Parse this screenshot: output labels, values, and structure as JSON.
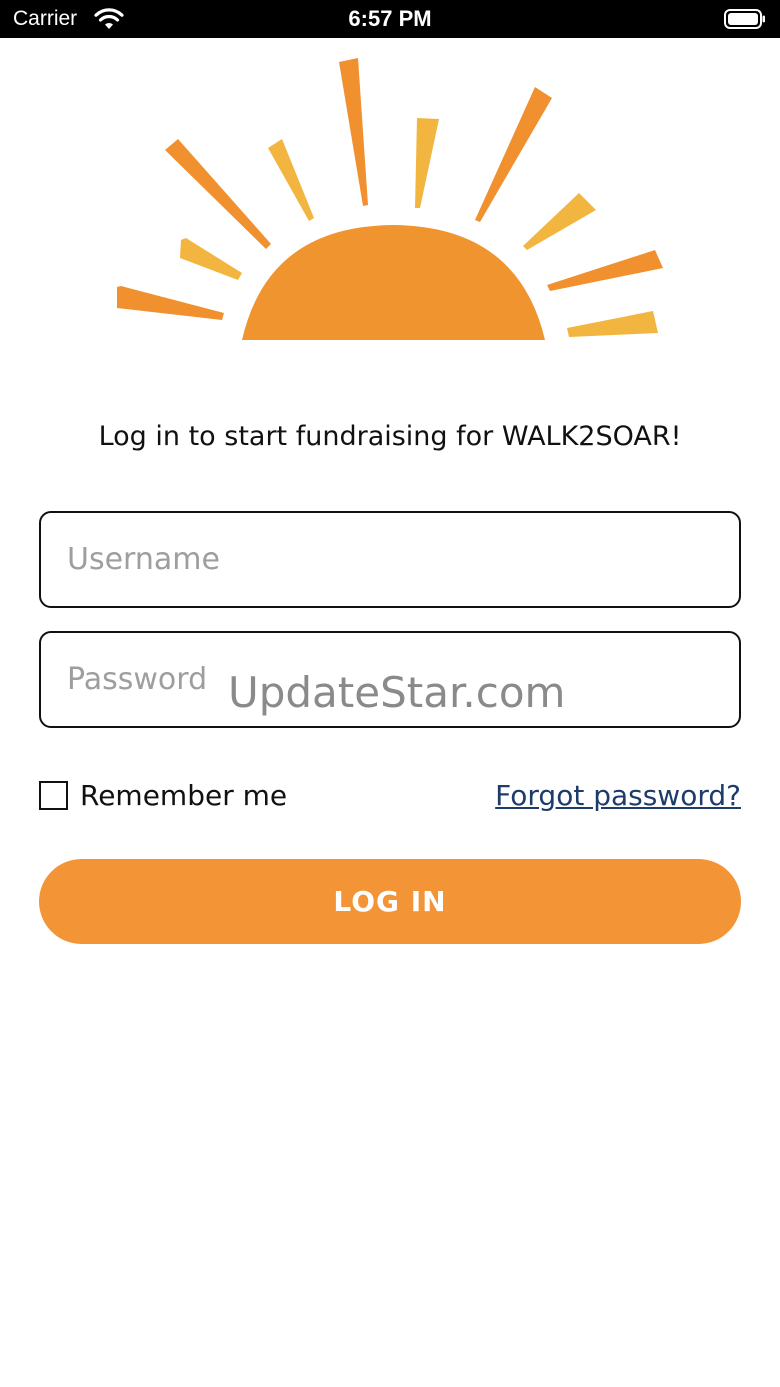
{
  "status_bar": {
    "carrier": "Carrier",
    "time": "6:57 PM",
    "wifi_icon": "wifi-icon",
    "battery_icon": "battery-icon"
  },
  "logo": {
    "icon": "sunrise-logo",
    "colors": {
      "sun": "#f0942f",
      "ray_dark": "#f0902e",
      "ray_light": "#f2b540"
    }
  },
  "tagline": "Log in to start fundraising for WALK2SOAR!",
  "form": {
    "username": {
      "placeholder": "Username",
      "value": ""
    },
    "password": {
      "placeholder": "Password",
      "value": ""
    },
    "remember_me": {
      "label": "Remember me",
      "checked": false
    },
    "forgot_password": "Forgot password?",
    "login_label": "LOG IN"
  },
  "watermark": "UpdateStar.com",
  "colors": {
    "accent": "#f39536",
    "link": "#1d3c6b"
  }
}
